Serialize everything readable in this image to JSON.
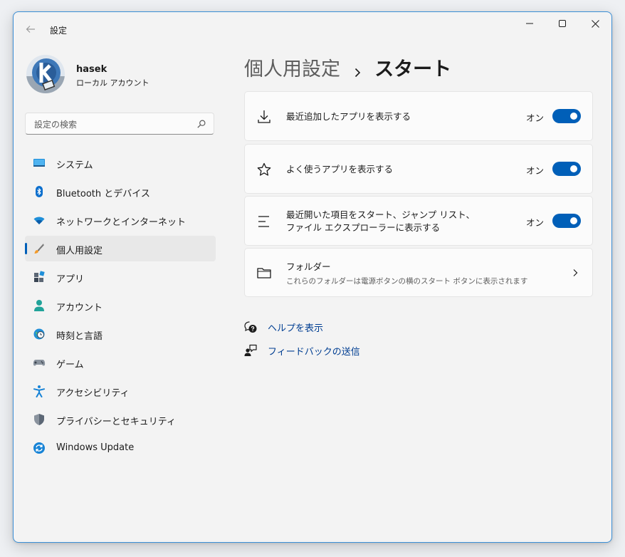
{
  "app": {
    "title": "設定"
  },
  "profile": {
    "name": "hasek",
    "account_type": "ローカル アカウント"
  },
  "search": {
    "placeholder": "設定の検索"
  },
  "nav": [
    {
      "label": "システム",
      "icon": "monitor-icon"
    },
    {
      "label": "Bluetooth とデバイス",
      "icon": "bluetooth-icon"
    },
    {
      "label": "ネットワークとインターネット",
      "icon": "wifi-icon"
    },
    {
      "label": "個人用設定",
      "icon": "brush-icon",
      "active": true
    },
    {
      "label": "アプリ",
      "icon": "apps-icon"
    },
    {
      "label": "アカウント",
      "icon": "person-icon"
    },
    {
      "label": "時刻と言語",
      "icon": "globe-clock-icon"
    },
    {
      "label": "ゲーム",
      "icon": "gamepad-icon"
    },
    {
      "label": "アクセシビリティ",
      "icon": "accessibility-icon"
    },
    {
      "label": "プライバシーとセキュリティ",
      "icon": "shield-icon"
    },
    {
      "label": "Windows Update",
      "icon": "update-icon"
    }
  ],
  "breadcrumb": {
    "parent": "個人用設定",
    "current": "スタート"
  },
  "settings": [
    {
      "title": "最近追加したアプリを表示する",
      "state": "オン",
      "on": true,
      "icon": "download-icon"
    },
    {
      "title": "よく使うアプリを表示する",
      "state": "オン",
      "on": true,
      "icon": "star-icon"
    },
    {
      "title_line1": "最近開いた項目をスタート、ジャンプ リスト、",
      "title_line2": "ファイル エクスプローラーに表示する",
      "state": "オン",
      "on": true,
      "icon": "list-icon"
    },
    {
      "title": "フォルダー",
      "subtitle": "これらのフォルダーは電源ボタンの横のスタート ボタンに表示されます",
      "icon": "folder-icon"
    }
  ],
  "links": [
    {
      "label": "ヘルプを表示",
      "icon": "help-icon"
    },
    {
      "label": "フィードバックの送信",
      "icon": "feedback-icon"
    }
  ],
  "colors": {
    "accent": "#005fb8",
    "link": "#003e92",
    "window_border": "#3b8fd6"
  }
}
